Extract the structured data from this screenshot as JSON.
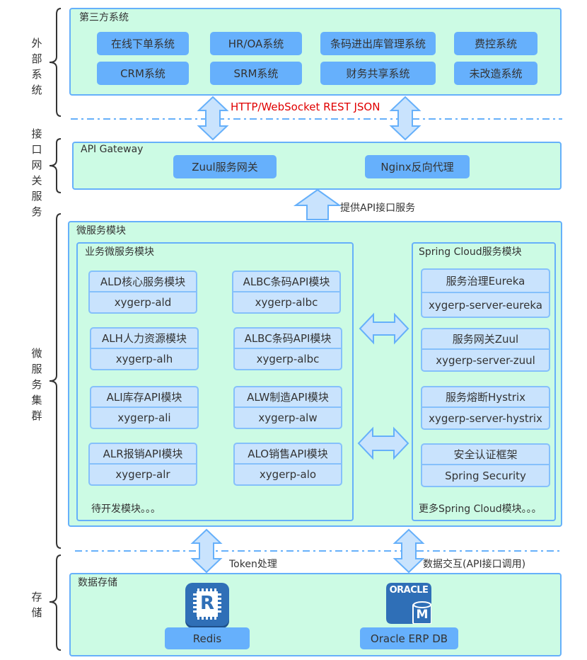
{
  "side_labels": {
    "external": "外部系统",
    "gateway": "接口网关服务",
    "microservice": "微服务集群",
    "storage": "存储"
  },
  "third_party": {
    "title": "第三方系统",
    "systems": [
      "在线下单系统",
      "HR/OA系统",
      "条码进出库管理系统",
      "费控系统",
      "CRM系统",
      "SRM系统",
      "财务共享系统",
      "未改造系统"
    ]
  },
  "protocol_label": "HTTP/WebSocket  REST JSON",
  "gateway": {
    "title": "API Gateway",
    "items": [
      "Zuul服务网关",
      "Nginx反向代理"
    ]
  },
  "api_service_label": "提供API接口服务",
  "microservices": {
    "title": "微服务模块",
    "business": {
      "title": "业务微服务模块",
      "modules": [
        {
          "name": "ALD核心服务模块",
          "id": "xygerp-ald"
        },
        {
          "name": "ALBC条码API模块",
          "id": "xygerp-albc"
        },
        {
          "name": "ALH人力资源模块",
          "id": "xygerp-alh"
        },
        {
          "name": "ALBC条码API模块",
          "id": "xygerp-albc"
        },
        {
          "name": "ALI库存API模块",
          "id": "xygerp-ali"
        },
        {
          "name": "ALW制造API模块",
          "id": "xygerp-alw"
        },
        {
          "name": "ALR报销API模块",
          "id": "xygerp-alr"
        },
        {
          "name": "ALO销售API模块",
          "id": "xygerp-alo"
        }
      ],
      "footer": "待开发模块。。。"
    },
    "spring_cloud": {
      "title": "Spring Cloud服务模块",
      "modules": [
        {
          "name": "服务治理Eureka",
          "id": "xygerp-server-eureka"
        },
        {
          "name": "服务网关Zuul",
          "id": "xygerp-server-zuul"
        },
        {
          "name": "服务熔断Hystrix",
          "id": "xygerp-server-hystrix"
        },
        {
          "name": "安全认证框架",
          "id": "Spring Security"
        }
      ],
      "footer": "更多Spring Cloud模块。。。"
    }
  },
  "token_label": "Token处理",
  "data_exchange_label": "数据交互(API接口调用)",
  "storage": {
    "title": "数据存储",
    "redis_label": "Redis",
    "redis_icon_letter": "R",
    "oracle_label": "Oracle ERP DB",
    "oracle_icon_text": "ORACLE",
    "oracle_icon_letter": "M"
  },
  "colors": {
    "panel_bg": "#ccfbe4",
    "panel_border": "#66b0fa",
    "button_bg": "#66b0fc",
    "card_bg": "#c9e3fd",
    "arrow_fill": "#c9e3fd",
    "protocol_text": "#e00000",
    "icon_blue": "#2f6fb7"
  }
}
